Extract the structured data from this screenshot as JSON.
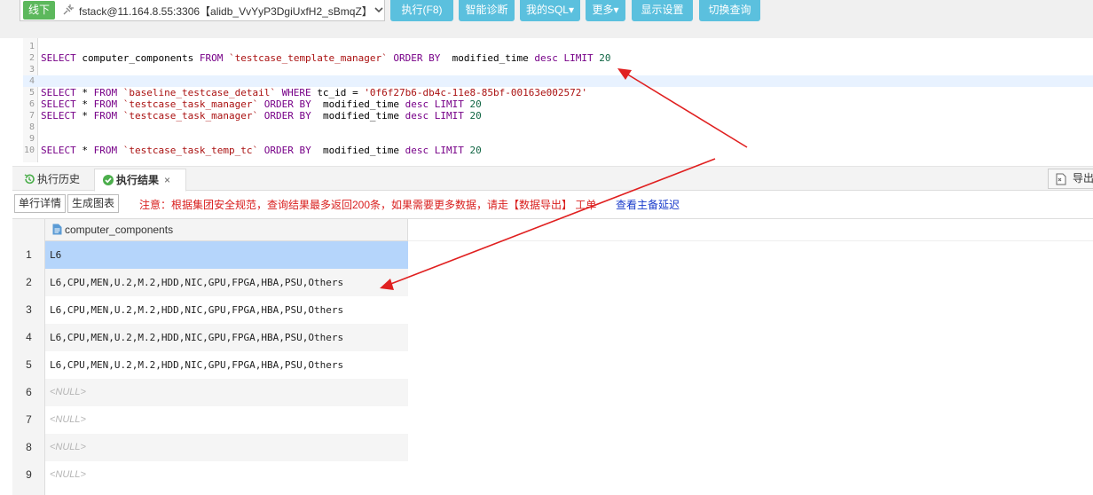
{
  "toolbar": {
    "env_badge": "线下",
    "connection": "fstack@11.164.8.55:3306【alidb_VvYyP3DgiUxfH2_sBmqZ】",
    "buttons": [
      {
        "label": "执行(F8)"
      },
      {
        "label": "智能诊断"
      },
      {
        "label": "我的SQL▾"
      },
      {
        "label": "更多▾"
      },
      {
        "label": "显示设置"
      },
      {
        "label": "切换查询"
      }
    ]
  },
  "editor": {
    "lines": [
      {
        "n": "1",
        "text": ""
      },
      {
        "n": "2",
        "text": "SELECT computer_components FROM `testcase_template_manager` ORDER BY  modified_time desc LIMIT 20"
      },
      {
        "n": "3",
        "text": ""
      },
      {
        "n": "4",
        "text": ""
      },
      {
        "n": "5",
        "text": "SELECT * FROM `baseline_testcase_detail` WHERE tc_id = '0f6f27b6-db4c-11e8-85bf-00163e002572'"
      },
      {
        "n": "6",
        "text": "SELECT * FROM `testcase_task_manager` ORDER BY  modified_time desc LIMIT 20"
      },
      {
        "n": "7",
        "text": "SELECT * FROM `testcase_task_manager` ORDER BY  modified_time desc LIMIT 20"
      },
      {
        "n": "8",
        "text": ""
      },
      {
        "n": "9",
        "text": ""
      },
      {
        "n": "10",
        "text": "SELECT * FROM `testcase_task_temp_tc` ORDER BY  modified_time desc LIMIT 20"
      }
    ]
  },
  "tabs": {
    "history": "执行历史",
    "result": "执行结果",
    "close": "×",
    "export": "导出结果"
  },
  "actions": {
    "row_detail": "单行详情",
    "make_chart": "生成图表",
    "notice": "注意：根据集团安全规范，查询结果最多返回200条，如果需要更多数据，请走【数据导出】 工单",
    "link": "查看主备延迟"
  },
  "grid": {
    "column": "computer_components",
    "rows": [
      {
        "n": "1",
        "value": "L6"
      },
      {
        "n": "2",
        "value": "L6,CPU,MEN,U.2,M.2,HDD,NIC,GPU,FPGA,HBA,PSU,Others"
      },
      {
        "n": "3",
        "value": "L6,CPU,MEN,U.2,M.2,HDD,NIC,GPU,FPGA,HBA,PSU,Others"
      },
      {
        "n": "4",
        "value": "L6,CPU,MEN,U.2,M.2,HDD,NIC,GPU,FPGA,HBA,PSU,Others"
      },
      {
        "n": "5",
        "value": "L6,CPU,MEN,U.2,M.2,HDD,NIC,GPU,FPGA,HBA,PSU,Others"
      },
      {
        "n": "6",
        "value": "<NULL>"
      },
      {
        "n": "7",
        "value": "<NULL>"
      },
      {
        "n": "8",
        "value": "<NULL>"
      },
      {
        "n": "9",
        "value": "<NULL>"
      }
    ]
  },
  "colors": {
    "env_badge": "#5cb85c",
    "toolbar_button": "#5bc0de",
    "notice": "#d9201f",
    "link": "#1a3ccc",
    "selected_row": "#b5d5fb",
    "annotation_arrow": "#e02020"
  }
}
